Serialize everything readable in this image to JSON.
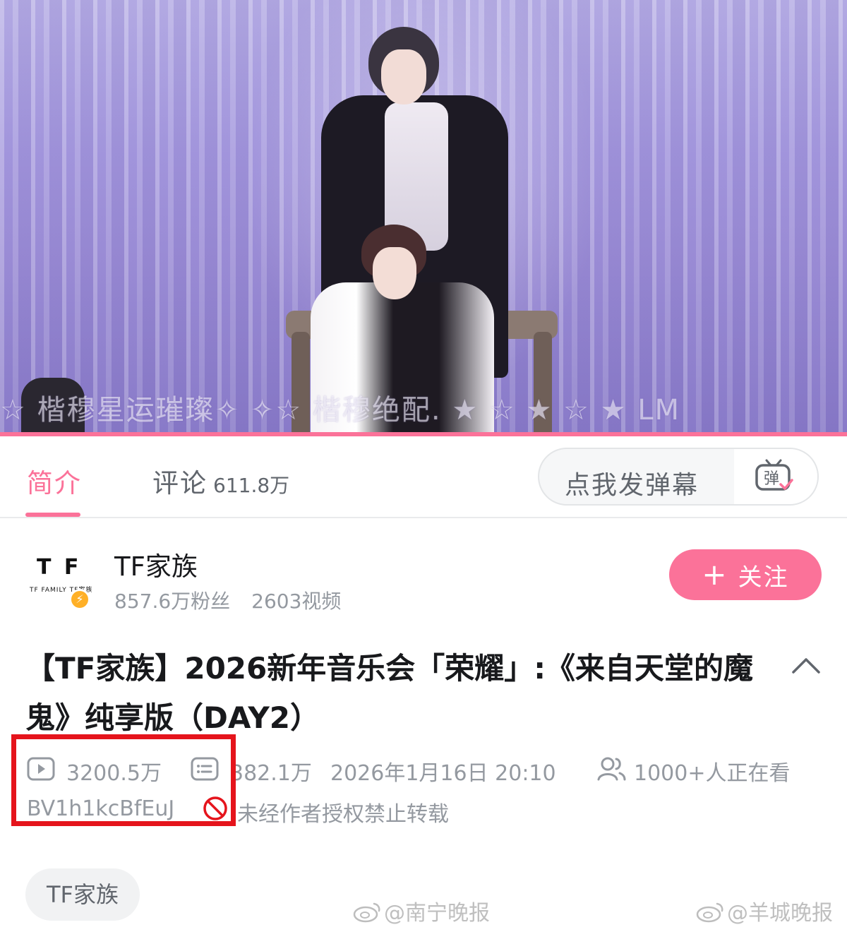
{
  "video": {
    "danmaku_overlay": "☆ 楷穆星运璀璨✧ ✧☆ 楷穆绝配. ★ ☆ ★ ☆ ★ LM",
    "progress": 1.0,
    "progress_color": "#fb7299"
  },
  "tabs": {
    "intro_label": "简介",
    "comments_label": "评论",
    "comments_count": "611.8万"
  },
  "danmaku": {
    "placeholder": "点我发弹幕",
    "toggle_icon_char": "弹"
  },
  "uploader": {
    "logo_mark": "T F",
    "logo_sub": "TF FAMILY TF家族",
    "name": "TF家族",
    "fans": "857.6万粉丝",
    "videos": "2603视频",
    "follow_plus": "+",
    "follow_label": "关注"
  },
  "video_info": {
    "title": "【TF家族】2026新年音乐会「荣耀」:《来自天堂的魔鬼》纯享版（DAY2）",
    "views": "3200.5万",
    "danmaku_count": "382.1万",
    "publish_time": "2026年1月16日 20:10",
    "watching_now": "1000+人正在看",
    "bvid": "BV1h1kcBfEuJ",
    "copyright_notice": "未经作者授权禁止转载"
  },
  "tags": [
    "TF家族"
  ],
  "watermarks": [
    "@南宁晚报",
    "@羊城晚报"
  ],
  "colors": {
    "accent": "#fb7299",
    "highlight_box": "#e5141c",
    "muted_text": "#9499a0"
  },
  "icons": {
    "views": "play-count-icon",
    "danmaku": "danmaku-count-icon",
    "watching": "people-icon",
    "no_repost": "prohibited-icon",
    "collapse": "chevron-up-icon"
  }
}
